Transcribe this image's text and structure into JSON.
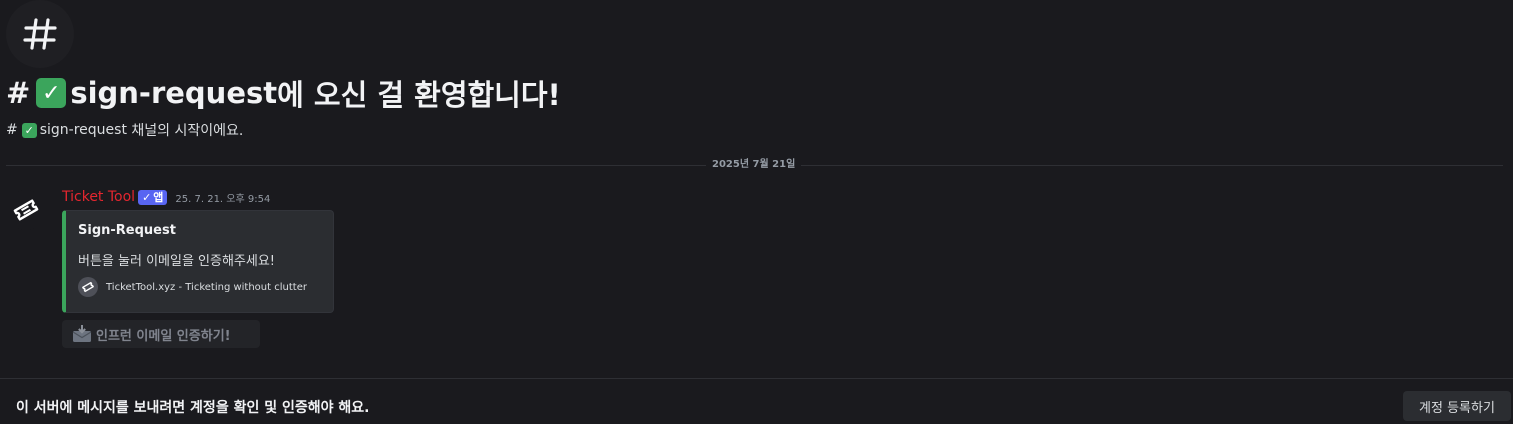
{
  "colors": {
    "background": "#1a1a1e",
    "author": "#e4262f",
    "embed_accent": "#3ba55c",
    "app_badge": "#5865f2"
  },
  "channel": {
    "hash_icon": "hash-icon",
    "hash_symbol": "#",
    "name": "sign-request",
    "welcome_suffix": "에 오신 걸 환영합니다!",
    "start_text": " 채널의 시작이에요.",
    "emoji": "check-emoji",
    "emoji_glyph": "✓"
  },
  "divider": {
    "date": "2025년 7월 21일"
  },
  "message": {
    "avatar_icon": "ticket-icon",
    "author": "Ticket Tool",
    "badge_check": "✓",
    "badge_label": "앱",
    "timestamp": "25. 7. 21. 오후 9:54",
    "embed": {
      "title": "Sign-Request",
      "description": "버튼을 눌러 이메일을 인증해주세요!",
      "footer_icon": "ticket-icon",
      "footer_text": "TicketTool.xyz - Ticketing without clutter"
    },
    "button": {
      "icon": "envelope-inbox-icon",
      "label": "인프런 이메일 인증하기!"
    }
  },
  "bottom_bar": {
    "notice": "이 서버에 메시지를 보내려면 계정을 확인 및 인증해야 해요.",
    "register_label": "계정 등록하기"
  }
}
